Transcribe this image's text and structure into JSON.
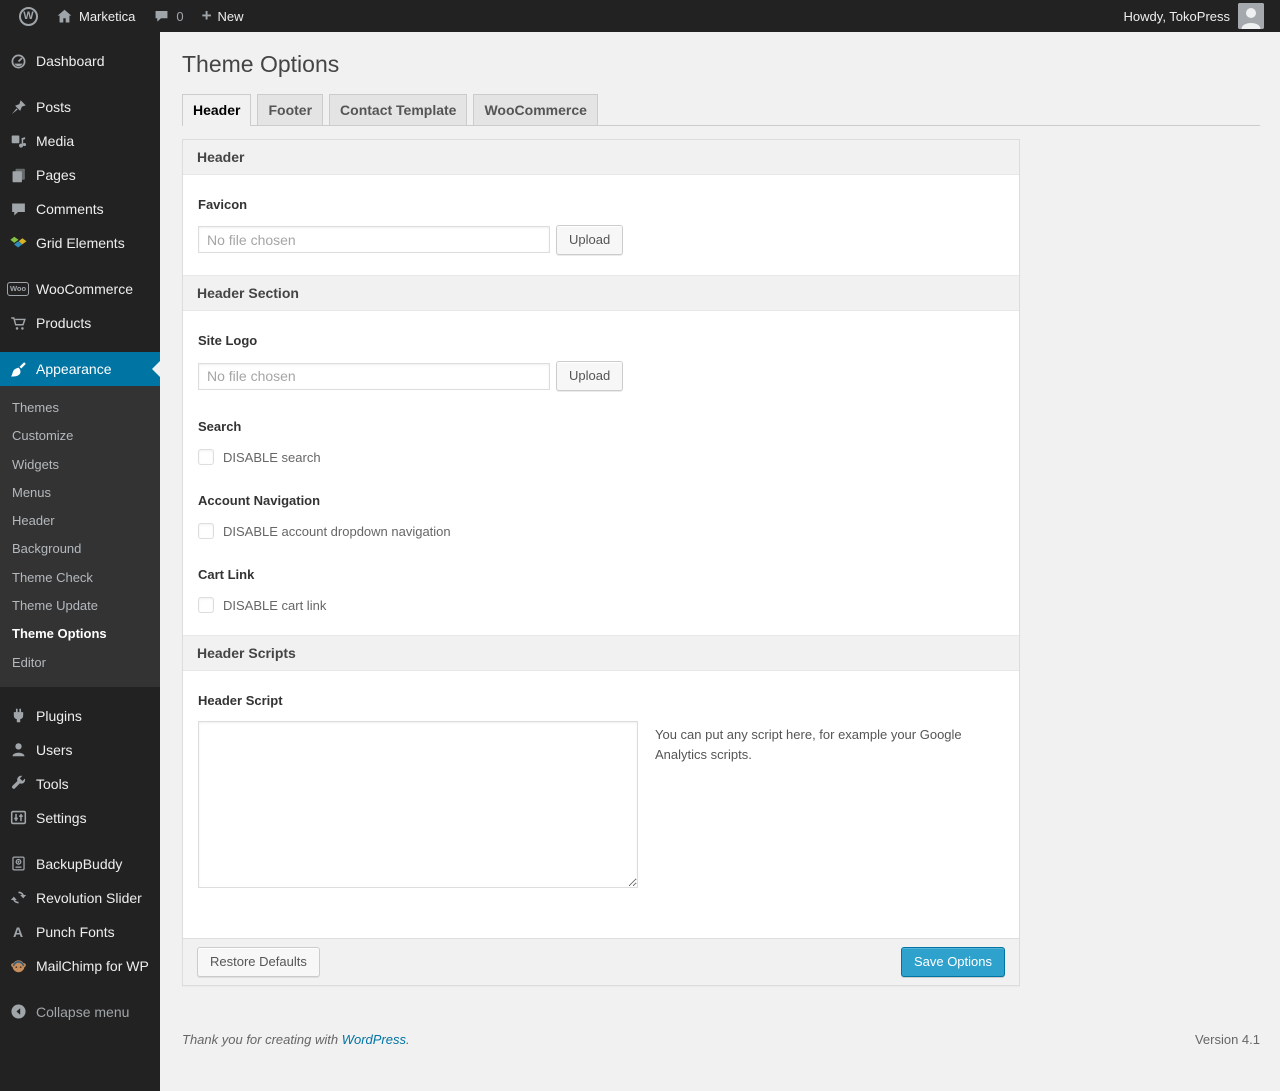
{
  "colors": {
    "accent": "#0074a2",
    "button_primary": "#2ea2cc",
    "link": "#0074a2",
    "menu_bg": "#222",
    "page_bg": "#f1f1f1"
  },
  "admin_bar": {
    "wp_logo_glyph": "W",
    "site_name": "Marketica",
    "comment_count": "0",
    "plus_glyph": "+",
    "new_label": "New",
    "howdy_text": "Howdy, TokoPress"
  },
  "sidebar": {
    "items": [
      {
        "label": "Dashboard"
      },
      {
        "label": "Posts"
      },
      {
        "label": "Media"
      },
      {
        "label": "Pages"
      },
      {
        "label": "Comments"
      },
      {
        "label": "Grid Elements"
      },
      {
        "label": "WooCommerce",
        "badge_glyph": "Woo"
      },
      {
        "label": "Products"
      },
      {
        "label": "Appearance",
        "active": true
      },
      {
        "label": "Plugins"
      },
      {
        "label": "Users"
      },
      {
        "label": "Tools"
      },
      {
        "label": "Settings"
      },
      {
        "label": "BackupBuddy"
      },
      {
        "label": "Revolution Slider"
      },
      {
        "label": "Punch Fonts",
        "glyph": "A"
      },
      {
        "label": "MailChimp for WP"
      },
      {
        "label": "Collapse menu"
      }
    ],
    "submenu": {
      "items": [
        {
          "label": "Themes"
        },
        {
          "label": "Customize"
        },
        {
          "label": "Widgets"
        },
        {
          "label": "Menus"
        },
        {
          "label": "Header"
        },
        {
          "label": "Background"
        },
        {
          "label": "Theme Check"
        },
        {
          "label": "Theme Update"
        },
        {
          "label": "Theme Options",
          "current": true
        },
        {
          "label": "Editor"
        }
      ]
    }
  },
  "main": {
    "title": "Theme Options",
    "tabs": [
      {
        "label": "Header",
        "active": true
      },
      {
        "label": "Footer"
      },
      {
        "label": "Contact Template"
      },
      {
        "label": "WooCommerce"
      }
    ],
    "panel": {
      "section_header_1": "Header",
      "favicon": {
        "label": "Favicon",
        "placeholder": "No file chosen",
        "upload": "Upload"
      },
      "section_header_2": "Header Section",
      "site_logo": {
        "label": "Site Logo",
        "placeholder": "No file chosen",
        "upload": "Upload"
      },
      "search": {
        "label": "Search",
        "checkbox": "DISABLE search"
      },
      "account_nav": {
        "label": "Account Navigation",
        "checkbox": "DISABLE account dropdown navigation"
      },
      "cart_link": {
        "label": "Cart Link",
        "checkbox": "DISABLE cart link"
      },
      "section_header_3": "Header Scripts",
      "header_script": {
        "label": "Header Script",
        "description": "You can put any script here, for example your Google Analytics scripts."
      },
      "footer": {
        "restore": "Restore Defaults",
        "save": "Save Options"
      }
    },
    "page_footer": {
      "thanks_prefix": "Thank you for creating with ",
      "link": "WordPress",
      "suffix": ".",
      "version": "Version 4.1"
    }
  }
}
